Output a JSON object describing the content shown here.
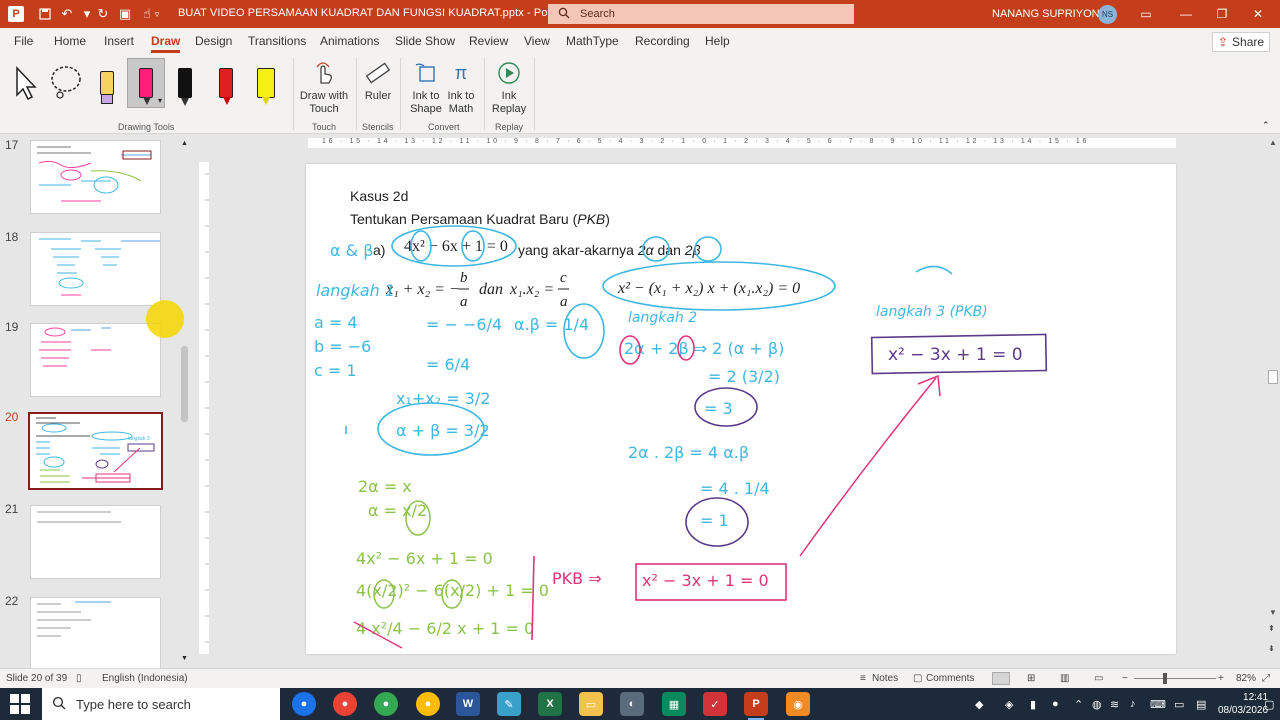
{
  "titlebar": {
    "doc_title": "BUAT VIDEO PERSAMAAN KUADRAT DAN FUNGSI KUADRAT.pptx  -  PowerPoint",
    "search_placeholder": "Search",
    "user_name": "NANANG SUPRIYONO",
    "user_initials": "NS",
    "accent_color": "#c43e1c"
  },
  "menu": {
    "items": [
      "File",
      "Home",
      "Insert",
      "Draw",
      "Design",
      "Transitions",
      "Animations",
      "Slide Show",
      "Review",
      "View",
      "MathType",
      "Recording",
      "Help"
    ],
    "active": "Draw",
    "share_label": "Share"
  },
  "ribbon": {
    "draw_with_touch": "Draw with Touch",
    "ruler": "Ruler",
    "ink_to_shape": "Ink to Shape",
    "ink_to_math": "Ink to Math",
    "ink_replay": "Ink Replay",
    "groups": {
      "drawing_tools": "Drawing Tools",
      "touch": "Touch",
      "stencils": "Stencils",
      "convert": "Convert",
      "replay": "Replay"
    }
  },
  "thumbnails": {
    "numbers": [
      "17",
      "18",
      "19",
      "20",
      "21",
      "22"
    ],
    "active": "20"
  },
  "ruler": {
    "h_ticks": "16 · 15 · 14 · 13 · 12 · 11 · 10 · 9 · 8 · 7 · 6 · 5 · 4 · 3 · 2 · 1 · 0 · 1 · 2 · 3 · 4 · 5 · 6 · 7 · 8 · 9 · 10 · 11 · 12 · 13 · 14 · 15 · 16"
  },
  "slide": {
    "heading1": "Kasus 2d",
    "heading2_pre": "Tentukan Persamaan Kuadrat Baru (",
    "heading2_italic": "PKB",
    "heading2_post": ")",
    "a_label": "a)",
    "equation_main": "4x² − 6x + 1 = 0",
    "roots_text_pre": "yang akar-akarnya ",
    "roots_alpha": "2α",
    "roots_mid": " dan ",
    "roots_beta": "2β",
    "vieta_sum": "x₁ + x₂ = −",
    "vieta_sum_num": "b",
    "vieta_sum_den": "a",
    "vieta_dan": "dan",
    "vieta_prod": "x₁.x₂ =",
    "vieta_prod_num": "c",
    "vieta_prod_den": "a",
    "general_form": "x² − (x₁ + x₂) x + (x₁.x₂) = 0",
    "hw_alpha_beta": "α & β",
    "hw_langkah1": "langkah 1",
    "hw_a": "a = 4",
    "hw_b": "b = −6",
    "hw_c": "c = 1",
    "hw_sum1": "= − −6/4",
    "hw_sum2": "= 6/4",
    "hw_sum3": "x₁+x₂ = 3/2",
    "hw_sum_box": "α + β = 3/2",
    "hw_prod": "α.β = 1/4",
    "hw_langkah2": "langkah 2",
    "hw_step2a": "2α + 2β ⇒ 2 (α + β)",
    "hw_step2b": "= 2 (3/2)",
    "hw_step2c": "= 3",
    "hw_step2d": "2α . 2β = 4 α.β",
    "hw_step2e": "= 4 . 1/4",
    "hw_step2f": "= 1",
    "hw_langkah3": "langkah 3 (PKB)",
    "hw_result": "x² − 3x + 1 = 0",
    "hw_sub1": "2α = x",
    "hw_sub2": "α = x/2",
    "hw_sub3": "4x² − 6x + 1 = 0",
    "hw_sub4": "4(x/2)² − 6(x/2) + 1 = 0",
    "hw_sub5": "4 x²/4 − 6/2 x + 1 = 0",
    "hw_pkb": "PKB ⇒",
    "hw_pkb_result": "x² − 3x + 1 = 0"
  },
  "status": {
    "slide_of": "Slide 20 of 39",
    "language": "English (Indonesia)",
    "notes": "Notes",
    "comments": "Comments",
    "zoom": "82%"
  },
  "taskbar": {
    "search_placeholder": "Type here to search",
    "time": "12:41",
    "date": "08/03/2026"
  }
}
